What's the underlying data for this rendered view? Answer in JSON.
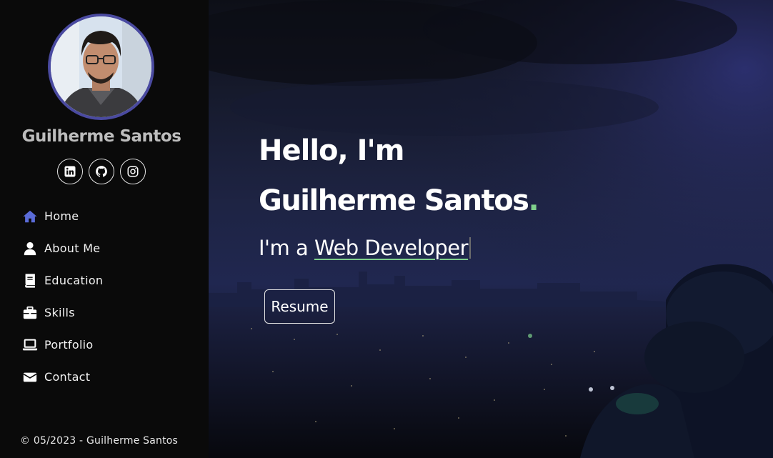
{
  "sidebar": {
    "profile_name": "Guilherme Santos",
    "avatar_icon": "profile-photo",
    "socials": [
      {
        "name": "linkedin-icon"
      },
      {
        "name": "github-icon"
      },
      {
        "name": "instagram-icon"
      }
    ],
    "nav": [
      {
        "label": "Home",
        "icon": "home-icon",
        "active": true
      },
      {
        "label": "About Me",
        "icon": "user-icon"
      },
      {
        "label": "Education",
        "icon": "book-icon"
      },
      {
        "label": "Skills",
        "icon": "briefcase-icon"
      },
      {
        "label": "Portfolio",
        "icon": "laptop-icon"
      },
      {
        "label": "Contact",
        "icon": "envelope-icon"
      }
    ],
    "footer": "© 05/2023 - Guilherme Santos"
  },
  "hero": {
    "greeting": "Hello, I'm",
    "name": "Guilherme Santos",
    "name_suffix": ".",
    "role_prefix": "I'm a ",
    "role": "Web Developer",
    "resume_label": "Resume"
  },
  "colors": {
    "accent": "#4a4aa0",
    "highlight": "#7fd08c",
    "sidebar_bg": "#0a0a0a"
  }
}
